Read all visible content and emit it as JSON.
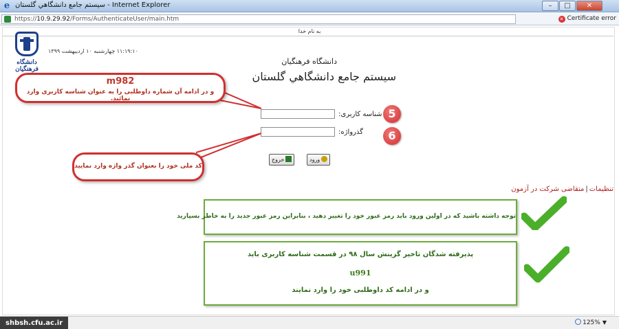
{
  "window": {
    "title": "سيستم جامع دانشگاهي گلستان - Internet Explorer",
    "minimize": "–",
    "maximize": "□",
    "close": "✕"
  },
  "address": {
    "scheme": "https://",
    "host": "10.9.29.92",
    "path": "/Forms/AuthenticateUser/main.htm",
    "cert_error": "Certificate error"
  },
  "page": {
    "bismillah": "به نام خدا",
    "datetime": "۱۱:۱۹:۱۰ چهارشنبه ۱۰ ارديبهشت ۱۳۹۹",
    "logo_text": "دانشگاه فرهنگیان",
    "university": "دانشگاه فرهنگيان",
    "system_title": "سيستم جامع دانشگاهي گلستان"
  },
  "login": {
    "username_label": "شناسه کاربری:",
    "password_label": "گذرواژه:",
    "username_value": "",
    "password_value": "",
    "login_button": "ورود",
    "exit_button": "خروج"
  },
  "steps": {
    "five": "5",
    "six": "6"
  },
  "callouts": {
    "username": {
      "code": "m982",
      "text": "و در ادامه آن شماره داوطلبی را به عنوان شناسه کاربری وارد نمائید."
    },
    "password": {
      "text": "کد ملی خود را بعنوان گذر واژه وارد نمایید"
    }
  },
  "links": {
    "settings": "تنظیمات",
    "separator": "|",
    "applicant": "متقاضی شرکت در آزمون"
  },
  "notices": {
    "first": {
      "text": "توجه داشته باشید که در اولین ورود باید رمز عبور خود را تغییر دهید ، بنابراین رمز عبور جدید را به خاطر بسپارید"
    },
    "second": {
      "line1": "پذیرفته شدگان تاخیر گزینش سال ۹۸ در قسمت شناسه کاربری باید",
      "code": "u991",
      "line3": "و در ادامه کد داوطلبی خود را وارد نمایند"
    }
  },
  "statusbar": {
    "watermark": "shbsh.cfu.ac.ir",
    "zoom": "125%",
    "zoom_arrow": "▼"
  },
  "colors": {
    "callout_border": "#d12f2f",
    "check_green": "#4caf2a",
    "notice_border": "#6aaa3a"
  }
}
